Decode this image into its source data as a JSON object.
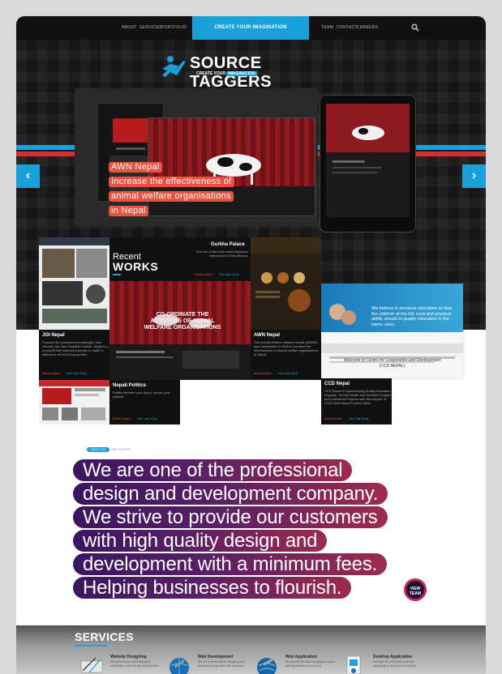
{
  "nav": {
    "left_links": [
      "ABOUT",
      "SERVICES",
      "PORTFOLIO"
    ],
    "cta": "CREATE YOUR IMAGINATION",
    "right_links": [
      "TEAM",
      "CONTACT",
      "CAREERS"
    ],
    "search_icon": "search-icon"
  },
  "hero": {
    "brand": "SOURCE TAGGERS",
    "tagline_prefix": "CREATE YOUR",
    "tagline_highlight": "IMAGINATION",
    "caption_lines": [
      "AWN Nepal",
      "Increase the effectiveness of",
      "animal welfare organisations",
      "in Nepal"
    ],
    "prev_icon": "chevron-left-icon",
    "next_icon": "chevron-right-icon",
    "accent": "#1aa1db",
    "caption_color": "#e8523f"
  },
  "works": {
    "recent": "Recent",
    "works": "WORKS",
    "launch_label": "launch project",
    "case_label": "view case study",
    "gurkha": {
      "title": "Gurkha Palace",
      "desc": "It is one of the best Indian Nepalese restaurant in Costa Blanca."
    },
    "jgi": {
      "title": "JGI Nepal",
      "desc": "Founded by renowned primatologist Jane Goodall, the Jane Goodall Institute, Nepal is a nonprofit that empowers people to make a difference for the living species."
    },
    "awn": {
      "title": "AWN Nepal",
      "desc": "The Animal Welfare Network Nepal (AWNN) was established in 2009 to increase the effectiveness of animal welfare organisations in Nepal."
    },
    "ccd": {
      "title": "CCD Nepal",
      "desc": "CCD Nepal is implementing Quality Education Program, School Health and Nutrition Program and Livelihood Program with the support of CCD Child Nepal Country Office.",
      "banner": "We believe in inclusive education so that the children of the hill, rural and physical ability should to quality education in the same class.",
      "welcome": "Welcome to Centre for Cooperation and Development",
      "welcome_sub": "(CCD NEPAL)"
    },
    "politics": {
      "title": "Nepali Politics",
      "desc": "Politics decides your future, decide your politics!"
    },
    "awn_screen": "CO-ORDINATE THE ACTIVITIES OF ANIMAL WELFARE ORGANISATIONS"
  },
  "about": {
    "tab_active": "ABOUT US",
    "tab_inactive": "OUR CLIENTS",
    "lines": [
      "We are one of the professional",
      "design and development company.",
      "We strive to provide our customers",
      "with high quality design and",
      "development with a minimum fees.",
      "Helping businesses to flourish."
    ],
    "view_team_1": "VIEW",
    "view_team_2": "TEAM"
  },
  "services": {
    "heading": "SERVICES",
    "items": [
      {
        "title": "Website Designing",
        "desc": "We provide you a well designed, informative, user friendly and attractive",
        "icon": "design-tools-icon"
      },
      {
        "title": "Web Development",
        "desc": "We are experienced in designing and developing large sites with advanced",
        "icon": "globe-wrench-icon"
      },
      {
        "title": "Web Application",
        "desc": "We provide the most innovative custom web applications to meet our",
        "icon": "globe-app-icon"
      },
      {
        "title": "Desktop Application",
        "desc": "We have the extensive expertise, knowledge & resources to develop",
        "icon": "desktop-app-icon"
      }
    ]
  }
}
